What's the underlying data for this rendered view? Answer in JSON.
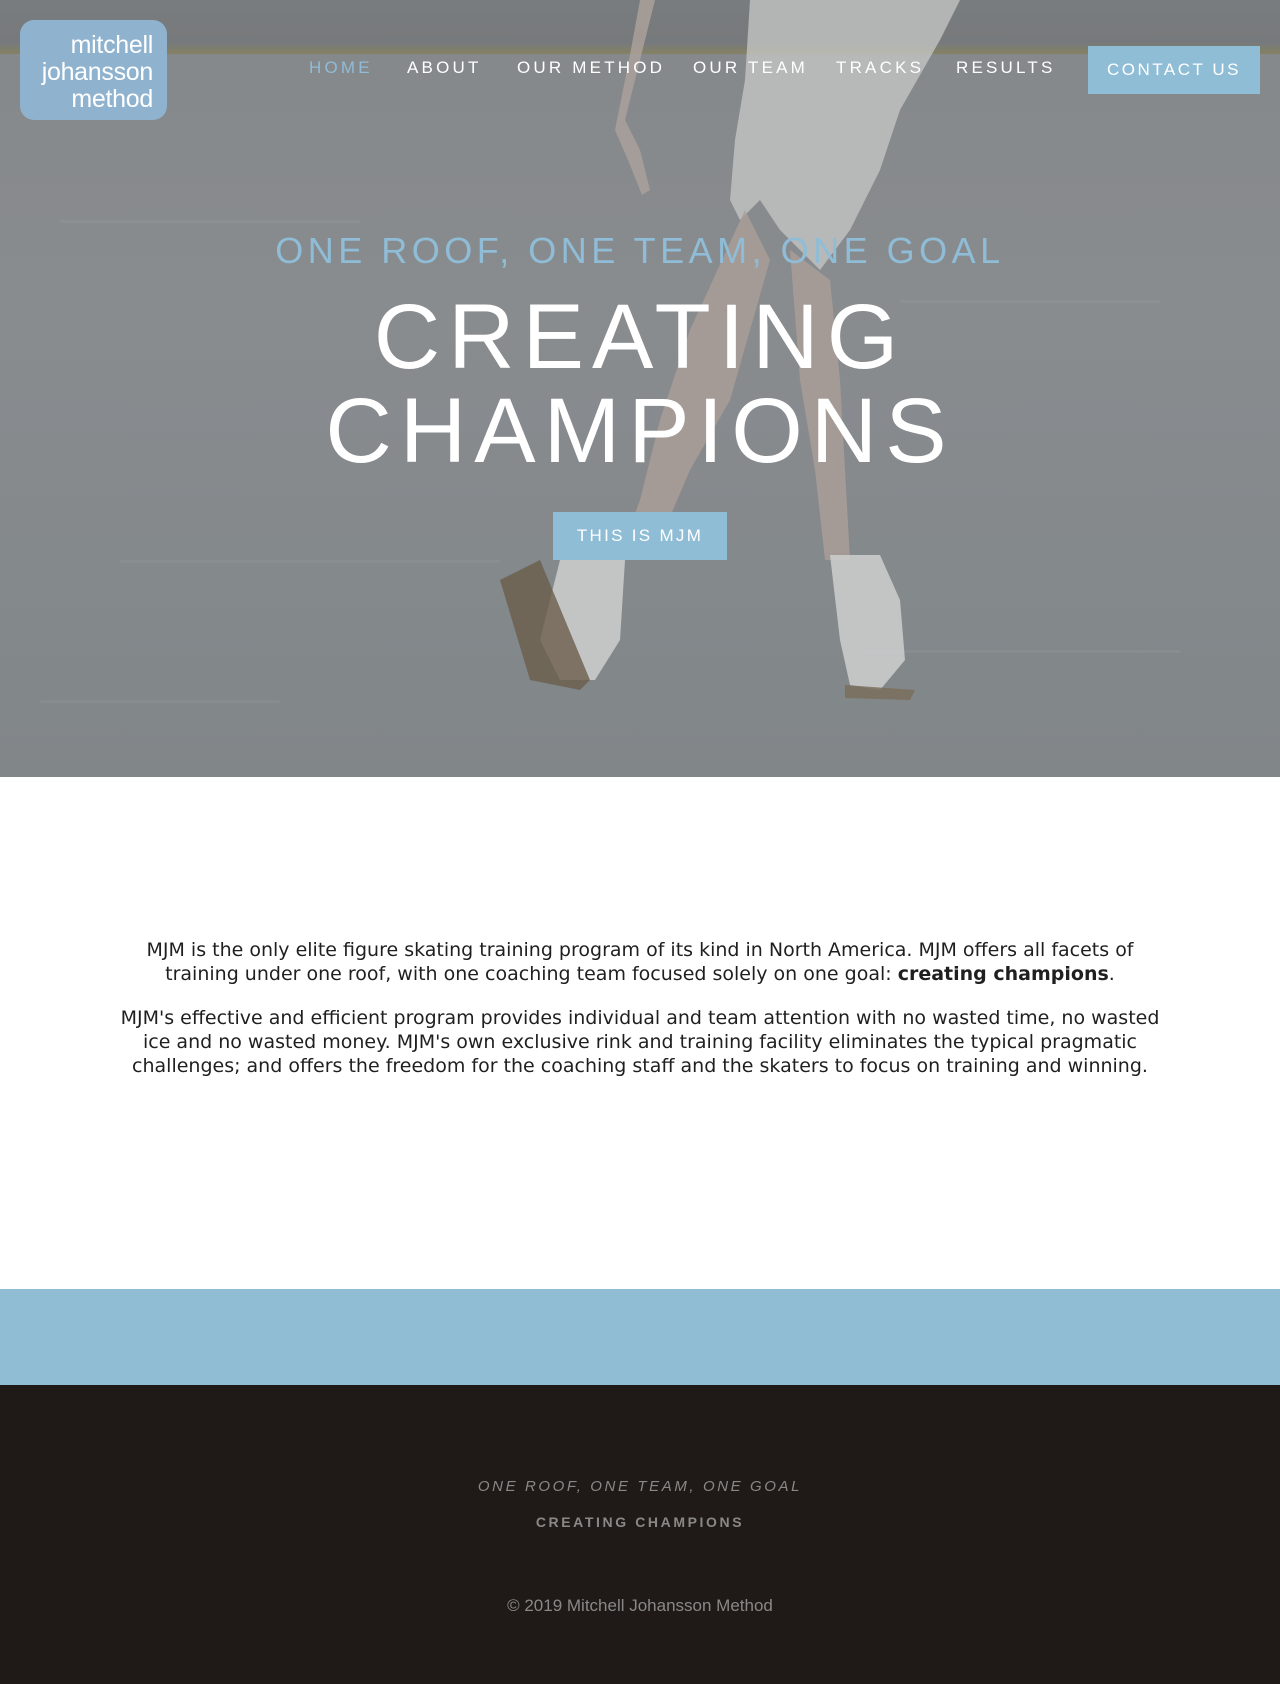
{
  "logo": {
    "line1": "mitchell",
    "line2": "johansson",
    "line3": "method"
  },
  "nav": {
    "items": [
      {
        "label": "HOME",
        "active": true
      },
      {
        "label": "ABOUT"
      },
      {
        "label": "OUR METHOD"
      },
      {
        "label": "OUR TEAM"
      },
      {
        "label": "TRACKS"
      },
      {
        "label": "RESULTS"
      }
    ],
    "contact_label": "CONTACT US"
  },
  "hero": {
    "tagline": "ONE ROOF, ONE TEAM, ONE GOAL",
    "headline_line1": "CREATING",
    "headline_line2": "CHAMPIONS",
    "cta_label": "THIS IS MJM"
  },
  "intro": {
    "p1_before": "MJM is the only elite figure skating training program of its kind in North America. MJM offers all facets of training under one roof, with one coaching team focused solely on one goal: ",
    "p1_bold": "creating champions",
    "p1_after": ".",
    "p2": "MJM's effective and efficient program provides individual and team attention with no wasted time, no wasted ice and no wasted money. MJM's own exclusive rink and training facility eliminates the typical pragmatic challenges; and offers the freedom for the coaching staff and the skaters to focus on training and winning."
  },
  "footer": {
    "tagline": "ONE ROOF, ONE TEAM, ONE GOAL",
    "subtitle": "CREATING CHAMPIONS",
    "copyright": "© 2019 Mitchell Johansson Method"
  },
  "colors": {
    "accent": "#8fbdd6",
    "footer_bg": "#1f1a17",
    "band": "#91bdd4"
  }
}
